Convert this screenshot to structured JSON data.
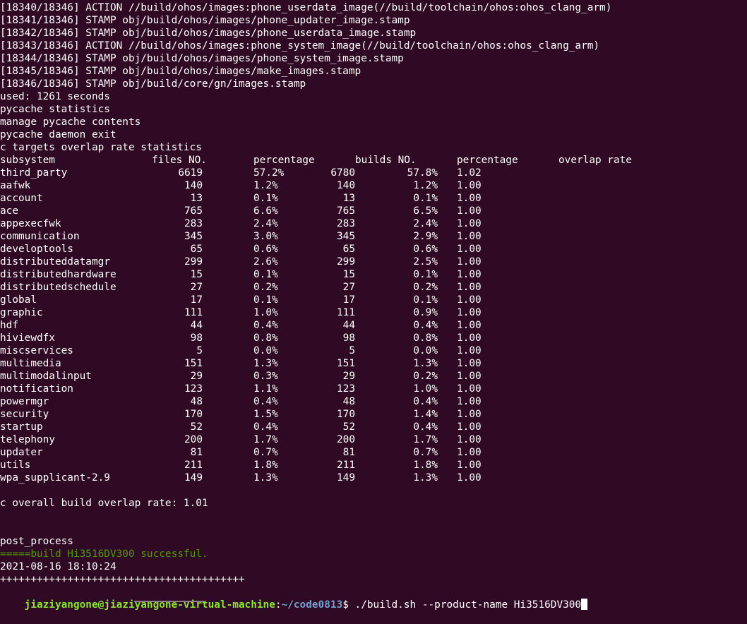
{
  "log_lines": [
    "[18340/18346] ACTION //build/ohos/images:phone_userdata_image(//build/toolchain/ohos:ohos_clang_arm)",
    "[18341/18346] STAMP obj/build/ohos/images/phone_updater_image.stamp",
    "[18342/18346] STAMP obj/build/ohos/images/phone_userdata_image.stamp",
    "[18343/18346] ACTION //build/ohos/images:phone_system_image(//build/toolchain/ohos:ohos_clang_arm)",
    "[18344/18346] STAMP obj/build/ohos/images/phone_system_image.stamp",
    "[18345/18346] STAMP obj/build/ohos/images/make_images.stamp",
    "[18346/18346] STAMP obj/build/core/gn/images.stamp",
    "used: 1261 seconds",
    "pycache statistics",
    "manage pycache contents",
    "pycache daemon exit",
    "c targets overlap rate statistics"
  ],
  "table": {
    "headers": [
      "subsystem",
      "files NO.",
      "percentage",
      "builds NO.",
      "percentage",
      "overlap rate"
    ],
    "rows": [
      [
        "third_party",
        "6619",
        "57.2%",
        "6780",
        "57.8%",
        "1.02"
      ],
      [
        "aafwk",
        "140",
        "1.2%",
        "140",
        "1.2%",
        "1.00"
      ],
      [
        "account",
        "13",
        "0.1%",
        "13",
        "0.1%",
        "1.00"
      ],
      [
        "ace",
        "765",
        "6.6%",
        "765",
        "6.5%",
        "1.00"
      ],
      [
        "appexecfwk",
        "283",
        "2.4%",
        "283",
        "2.4%",
        "1.00"
      ],
      [
        "communication",
        "345",
        "3.0%",
        "345",
        "2.9%",
        "1.00"
      ],
      [
        "developtools",
        "65",
        "0.6%",
        "65",
        "0.6%",
        "1.00"
      ],
      [
        "distributeddatamgr",
        "299",
        "2.6%",
        "299",
        "2.5%",
        "1.00"
      ],
      [
        "distributedhardware",
        "15",
        "0.1%",
        "15",
        "0.1%",
        "1.00"
      ],
      [
        "distributedschedule",
        "27",
        "0.2%",
        "27",
        "0.2%",
        "1.00"
      ],
      [
        "global",
        "17",
        "0.1%",
        "17",
        "0.1%",
        "1.00"
      ],
      [
        "graphic",
        "111",
        "1.0%",
        "111",
        "0.9%",
        "1.00"
      ],
      [
        "hdf",
        "44",
        "0.4%",
        "44",
        "0.4%",
        "1.00"
      ],
      [
        "hiviewdfx",
        "98",
        "0.8%",
        "98",
        "0.8%",
        "1.00"
      ],
      [
        "miscservices",
        "5",
        "0.0%",
        "5",
        "0.0%",
        "1.00"
      ],
      [
        "multimedia",
        "151",
        "1.3%",
        "151",
        "1.3%",
        "1.00"
      ],
      [
        "multimodalinput",
        "29",
        "0.3%",
        "29",
        "0.2%",
        "1.00"
      ],
      [
        "notification",
        "123",
        "1.1%",
        "123",
        "1.0%",
        "1.00"
      ],
      [
        "powermgr",
        "48",
        "0.4%",
        "48",
        "0.4%",
        "1.00"
      ],
      [
        "security",
        "170",
        "1.5%",
        "170",
        "1.4%",
        "1.00"
      ],
      [
        "startup",
        "52",
        "0.4%",
        "52",
        "0.4%",
        "1.00"
      ],
      [
        "telephony",
        "200",
        "1.7%",
        "200",
        "1.7%",
        "1.00"
      ],
      [
        "updater",
        "81",
        "0.7%",
        "81",
        "0.7%",
        "1.00"
      ],
      [
        "utils",
        "211",
        "1.8%",
        "211",
        "1.8%",
        "1.00"
      ],
      [
        "wpa_supplicant-2.9",
        "149",
        "1.3%",
        "149",
        "1.3%",
        "1.00"
      ]
    ]
  },
  "overall_rate": "c overall build overlap rate: 1.01",
  "post_process": "post_process",
  "success_message": "=====build Hi3516DV300 successful.",
  "timestamp": "2021-08-16 18:10:24",
  "separator": "++++++++++++++++++++++++++++++++++++++++",
  "prompt": {
    "user_host": "jiaziyangone@jiaziyangone-virtual-machine",
    "colon": ":",
    "path": "~/code0813",
    "dollar": "$ ",
    "command": "./build.sh --product-name Hi3516DV300"
  },
  "colors": {
    "background": "#300a24",
    "text": "#ffffff",
    "success": "#4e9a06",
    "prompt_user": "#8ae234",
    "prompt_path": "#729fcf"
  }
}
